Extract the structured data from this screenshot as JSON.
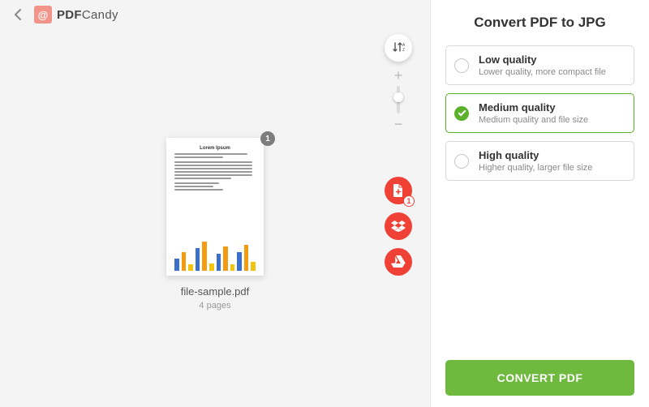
{
  "brand": {
    "mark": "@",
    "name_prefix": "PDF",
    "name_suffix": "Candy"
  },
  "file": {
    "name": "file-sample.pdf",
    "pages_label": "4 pages",
    "preview_title": "Lorem Ipsum",
    "page_badge": "1"
  },
  "upload": {
    "file_count_badge": "1"
  },
  "panel": {
    "title": "Convert PDF to JPG",
    "options": [
      {
        "title": "Low quality",
        "sub": "Lower quality, more compact file",
        "selected": false
      },
      {
        "title": "Medium quality",
        "sub": "Medium quality and file size",
        "selected": true
      },
      {
        "title": "High quality",
        "sub": "Higher quality, larger file size",
        "selected": false
      }
    ],
    "convert_label": "CONVERT PDF"
  }
}
